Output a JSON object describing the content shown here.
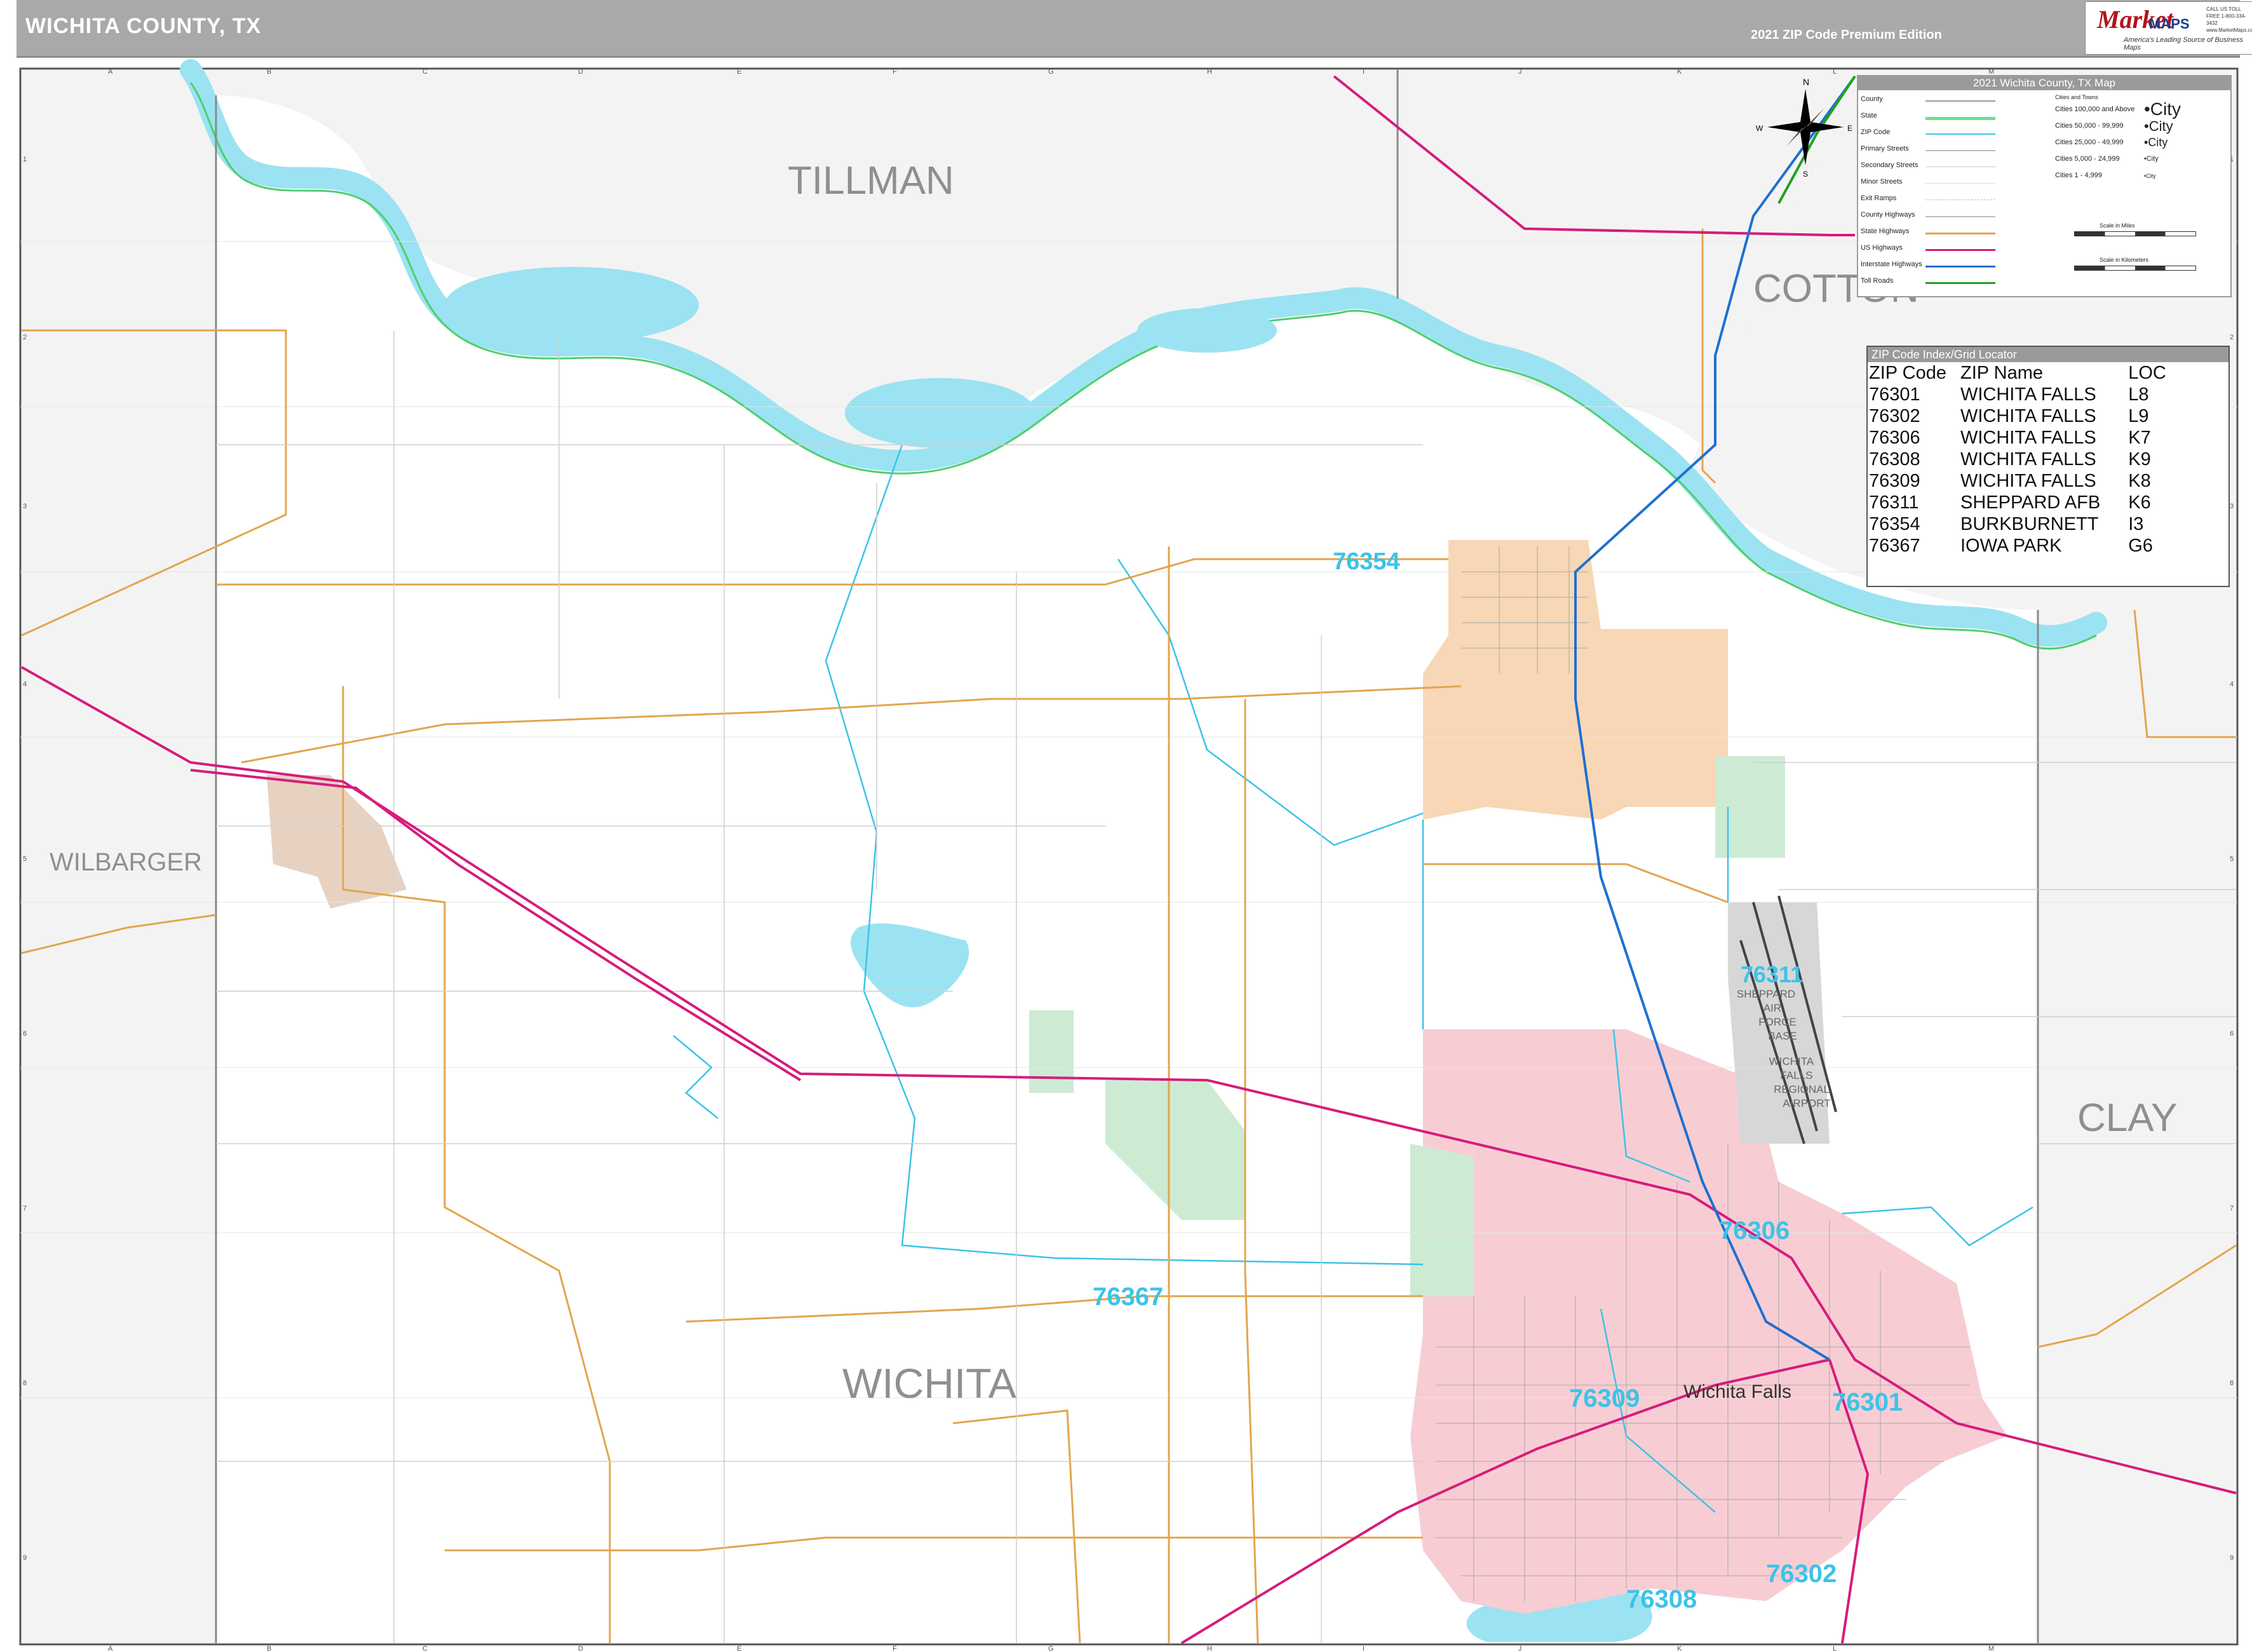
{
  "header": {
    "title": "WICHITA COUNTY, TX",
    "edition": "2021 ZIP Code Premium Edition"
  },
  "logo": {
    "brand": "Market",
    "maps": "MAPS",
    "tagline": "America's Leading Source of Business Maps",
    "contact": "CALL US TOLL FREE 1-800-334-3432 www.MarketMaps.com"
  },
  "map": {
    "county_labels": [
      "TILLMAN",
      "COTTON",
      "WILBARGER",
      "CLAY",
      "WICHITA"
    ],
    "zip_labels": [
      "76354",
      "76311",
      "76306",
      "76367",
      "76309",
      "76301",
      "76302",
      "76308"
    ],
    "city_labels": [
      "Wichita Falls"
    ],
    "base_labels": [
      "SHEPPARD",
      "AIR",
      "FORCE",
      "BASE",
      "WICHITA",
      "FALLS",
      "REGIONAL",
      "AIRPORT"
    ],
    "grid_columns": [
      "A",
      "B",
      "C",
      "D",
      "E",
      "F",
      "G",
      "H",
      "I",
      "J",
      "K",
      "L",
      "M"
    ],
    "grid_rows": [
      "1",
      "2",
      "3",
      "4",
      "5",
      "6",
      "7",
      "8",
      "9"
    ],
    "colors": {
      "water": "#9be3f2",
      "zip_76354": "#f7d7b5",
      "zip_wichita_falls": "#f7cdd3",
      "zip_76367": "#cdebd3",
      "county_outside": "#f3f3f3",
      "interstate": "#1f6fd1",
      "us_highway": "#d61c7c",
      "state_highway": "#e3a54c",
      "zip_boundary": "#3cc3e8"
    },
    "compass": {
      "n": "N",
      "e": "E",
      "s": "S",
      "w": "W"
    }
  },
  "legend": {
    "title": "2021 Wichita County, TX Map",
    "items": [
      "County",
      "State",
      "ZIP Code",
      "Primary Streets",
      "Secondary Streets",
      "Minor Streets",
      "Exit Ramps",
      "County Highways",
      "State Highways",
      "US Highways",
      "Interstate Highways",
      "Toll Roads"
    ],
    "cities_header": "Cities and Towns",
    "cities": [
      {
        "label": "Cities 100,000 and Above",
        "sample": "•City"
      },
      {
        "label": "Cities 50,000 - 99,999",
        "sample": "•City"
      },
      {
        "label": "Cities 25,000 - 49,999",
        "sample": "•City"
      },
      {
        "label": "Cities 5,000 - 24,999",
        "sample": "•City"
      },
      {
        "label": "Cities 1 - 4,999",
        "sample": "•City"
      }
    ],
    "scale_miles": "Scale in Miles",
    "scale_km": "Scale in Kilometers"
  },
  "zip_index": {
    "title": "ZIP Code Index/Grid Locator",
    "columns": [
      "ZIP Code",
      "ZIP Name",
      "LOC"
    ],
    "rows": [
      [
        "76301",
        "WICHITA FALLS",
        "L8"
      ],
      [
        "76302",
        "WICHITA FALLS",
        "L9"
      ],
      [
        "76306",
        "WICHITA FALLS",
        "K7"
      ],
      [
        "76308",
        "WICHITA FALLS",
        "K9"
      ],
      [
        "76309",
        "WICHITA FALLS",
        "K8"
      ],
      [
        "76311",
        "SHEPPARD AFB",
        "K6"
      ],
      [
        "76354",
        "BURKBURNETT",
        "I3"
      ],
      [
        "76367",
        "IOWA PARK",
        "G6"
      ]
    ]
  }
}
